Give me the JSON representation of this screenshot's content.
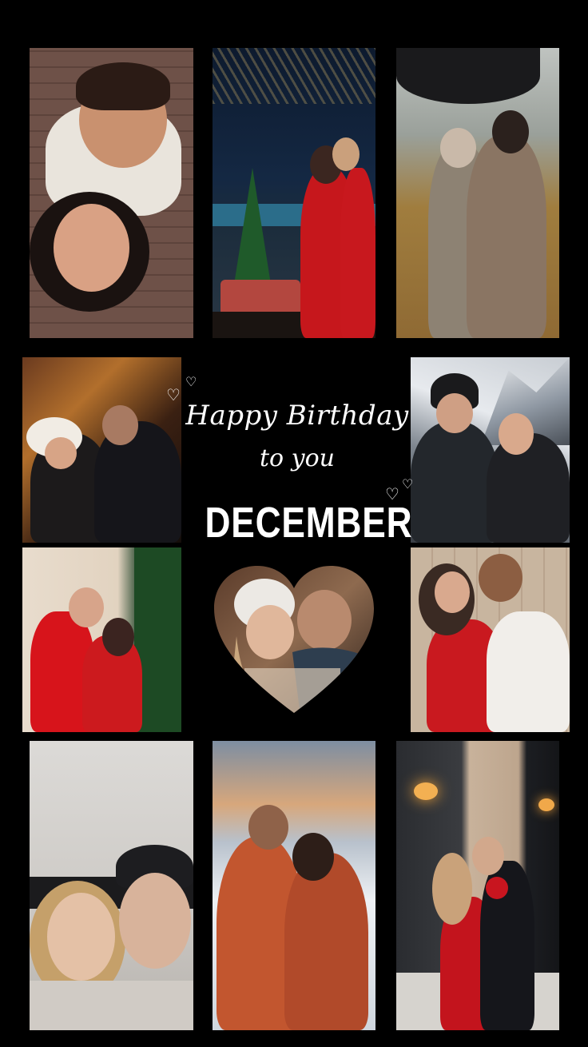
{
  "greeting": {
    "line1": "Happy Birthday",
    "line2": "to you",
    "month": "DECEMBER"
  },
  "icons": {
    "doodle_left": "heart-outline-icon",
    "doodle_right": "heart-outline-icon"
  },
  "colors": {
    "background": "#000000",
    "text": "#ffffff",
    "accent_red": "#d31b22"
  },
  "photos": [
    {
      "name": "selfie-couple-street"
    },
    {
      "name": "christmas-tree-couple-night"
    },
    {
      "name": "umbrella-couple-autumn"
    },
    {
      "name": "christmas-market-couple"
    },
    {
      "name": "snowy-mountain-couple"
    },
    {
      "name": "red-outfit-christmas-tree-couple"
    },
    {
      "name": "red-dress-hug-couple"
    },
    {
      "name": "lying-selfie-couple"
    },
    {
      "name": "blanket-snow-sunset-couple"
    },
    {
      "name": "red-dress-flowers-couple"
    }
  ]
}
